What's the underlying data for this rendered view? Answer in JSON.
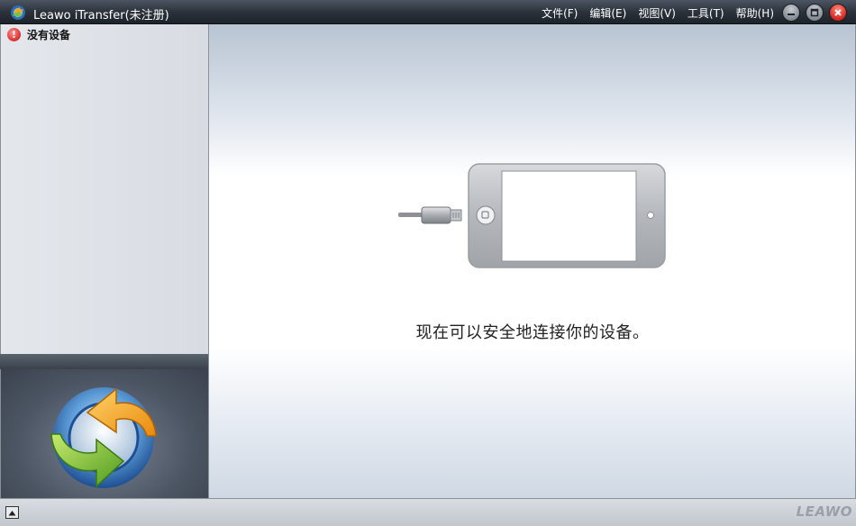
{
  "window": {
    "title": "Leawo iTransfer(未注册)"
  },
  "menu": {
    "items": [
      {
        "label": "文件(F)"
      },
      {
        "label": "编辑(E)"
      },
      {
        "label": "视图(V)"
      },
      {
        "label": "工具(T)"
      },
      {
        "label": "帮助(H)"
      }
    ]
  },
  "window_controls": [
    "minimize-icon",
    "restore-icon",
    "close-icon"
  ],
  "sidebar": {
    "status_icon": "warning-icon",
    "status_label": "没有设备"
  },
  "main": {
    "connect_message": "现在可以安全地连接你的设备。"
  },
  "statusbar": {
    "brand": "LEAWO"
  },
  "colors": {
    "close_button": "#e0302a",
    "warning": "#e23a3a",
    "logo_orange": "#f5a623",
    "logo_green": "#7ac143",
    "logo_blue": "#2a6fb8"
  }
}
